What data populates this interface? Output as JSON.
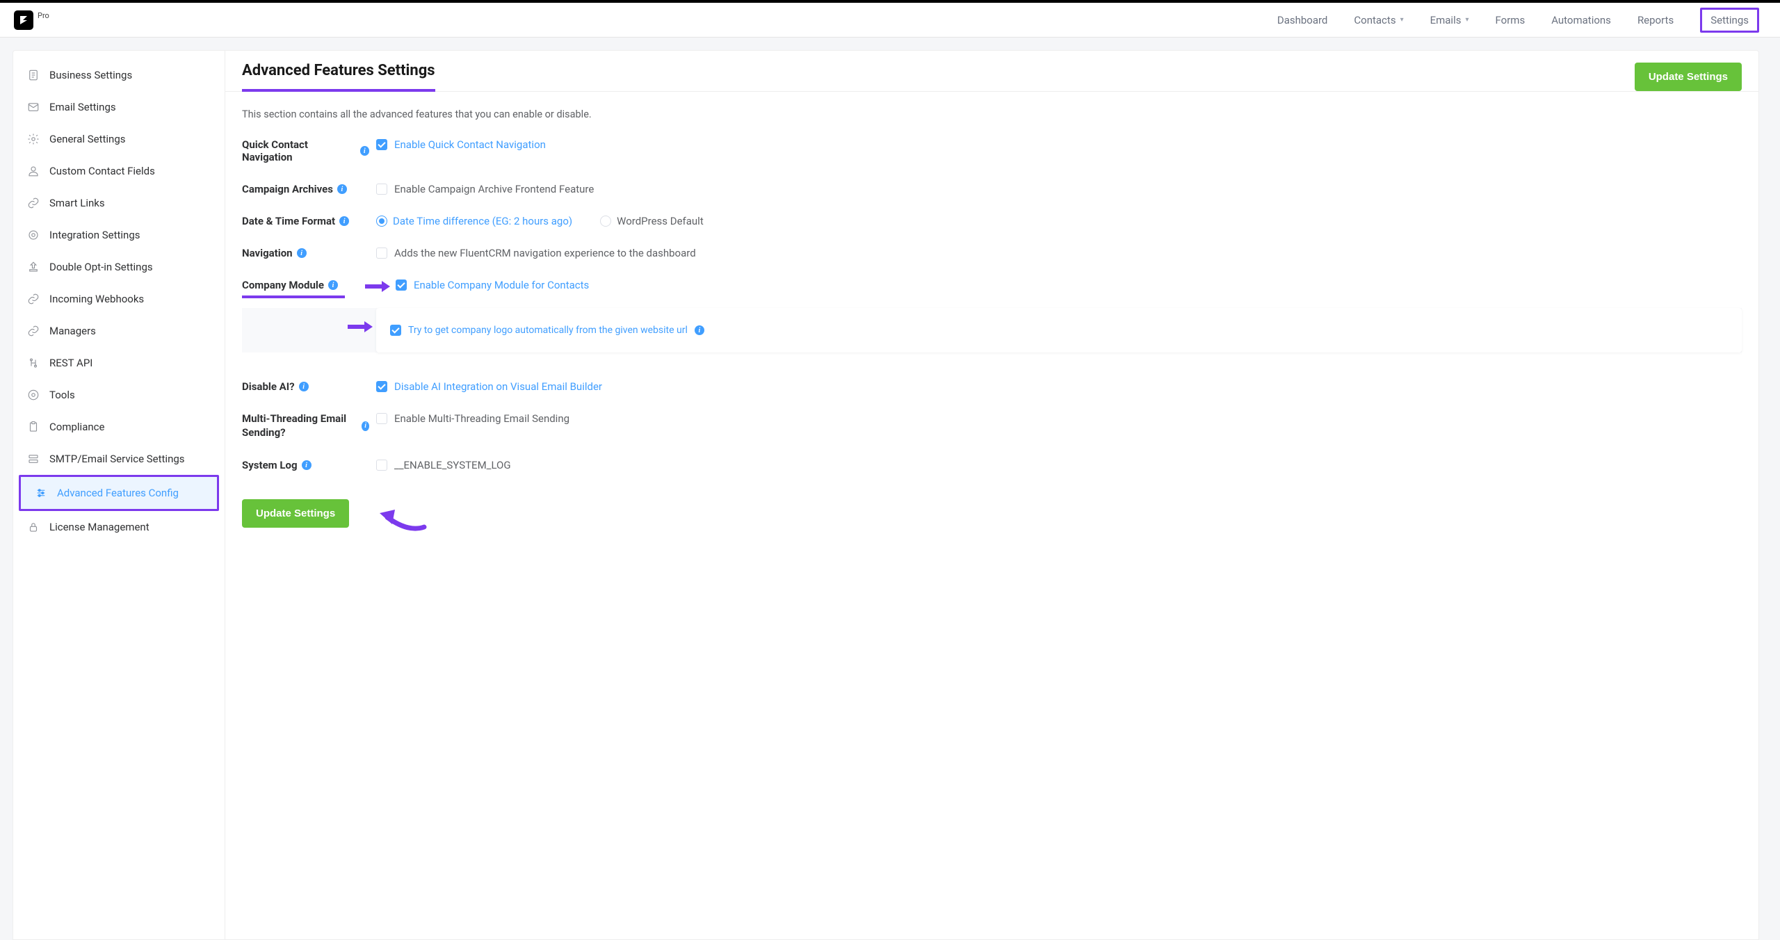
{
  "app": {
    "badge": "Pro"
  },
  "nav": {
    "dashboard": "Dashboard",
    "contacts": "Contacts",
    "emails": "Emails",
    "forms": "Forms",
    "automations": "Automations",
    "reports": "Reports",
    "settings": "Settings"
  },
  "sidebar": {
    "items": [
      {
        "label": "Business Settings"
      },
      {
        "label": "Email Settings"
      },
      {
        "label": "General Settings"
      },
      {
        "label": "Custom Contact Fields"
      },
      {
        "label": "Smart Links"
      },
      {
        "label": "Integration Settings"
      },
      {
        "label": "Double Opt-in Settings"
      },
      {
        "label": "Incoming Webhooks"
      },
      {
        "label": "Managers"
      },
      {
        "label": "REST API"
      },
      {
        "label": "Tools"
      },
      {
        "label": "Compliance"
      },
      {
        "label": "SMTP/Email Service Settings"
      },
      {
        "label": "Advanced Features Config"
      },
      {
        "label": "License Management"
      }
    ]
  },
  "main": {
    "title": "Advanced Features Settings",
    "update_btn": "Update Settings",
    "desc": "This section contains all the advanced features that you can enable or disable.",
    "rows": {
      "quick_contact": {
        "label": "Quick Contact Navigation",
        "option": "Enable Quick Contact Navigation",
        "checked": true
      },
      "campaign_archives": {
        "label": "Campaign Archives",
        "option": "Enable Campaign Archive Frontend Feature",
        "checked": false
      },
      "datetime": {
        "label": "Date & Time Format",
        "opt1": "Date Time difference (EG: 2 hours ago)",
        "opt2": "WordPress Default",
        "selected": 0
      },
      "navigation": {
        "label": "Navigation",
        "option": "Adds the new FluentCRM navigation experience to the dashboard",
        "checked": false
      },
      "company_module": {
        "label": "Company Module",
        "option": "Enable Company Module for Contacts",
        "nested": "Try to get company logo automatically from the given website url",
        "checked": true,
        "nested_checked": true
      },
      "disable_ai": {
        "label": "Disable AI?",
        "option": "Disable AI Integration on Visual Email Builder",
        "checked": true
      },
      "multi_thread": {
        "label": "Multi-Threading Email Sending?",
        "option": "Enable Multi-Threading Email Sending",
        "checked": false
      },
      "system_log": {
        "label": "System Log",
        "option": "__ENABLE_SYSTEM_LOG",
        "checked": false
      }
    },
    "update_btn2": "Update Settings"
  }
}
